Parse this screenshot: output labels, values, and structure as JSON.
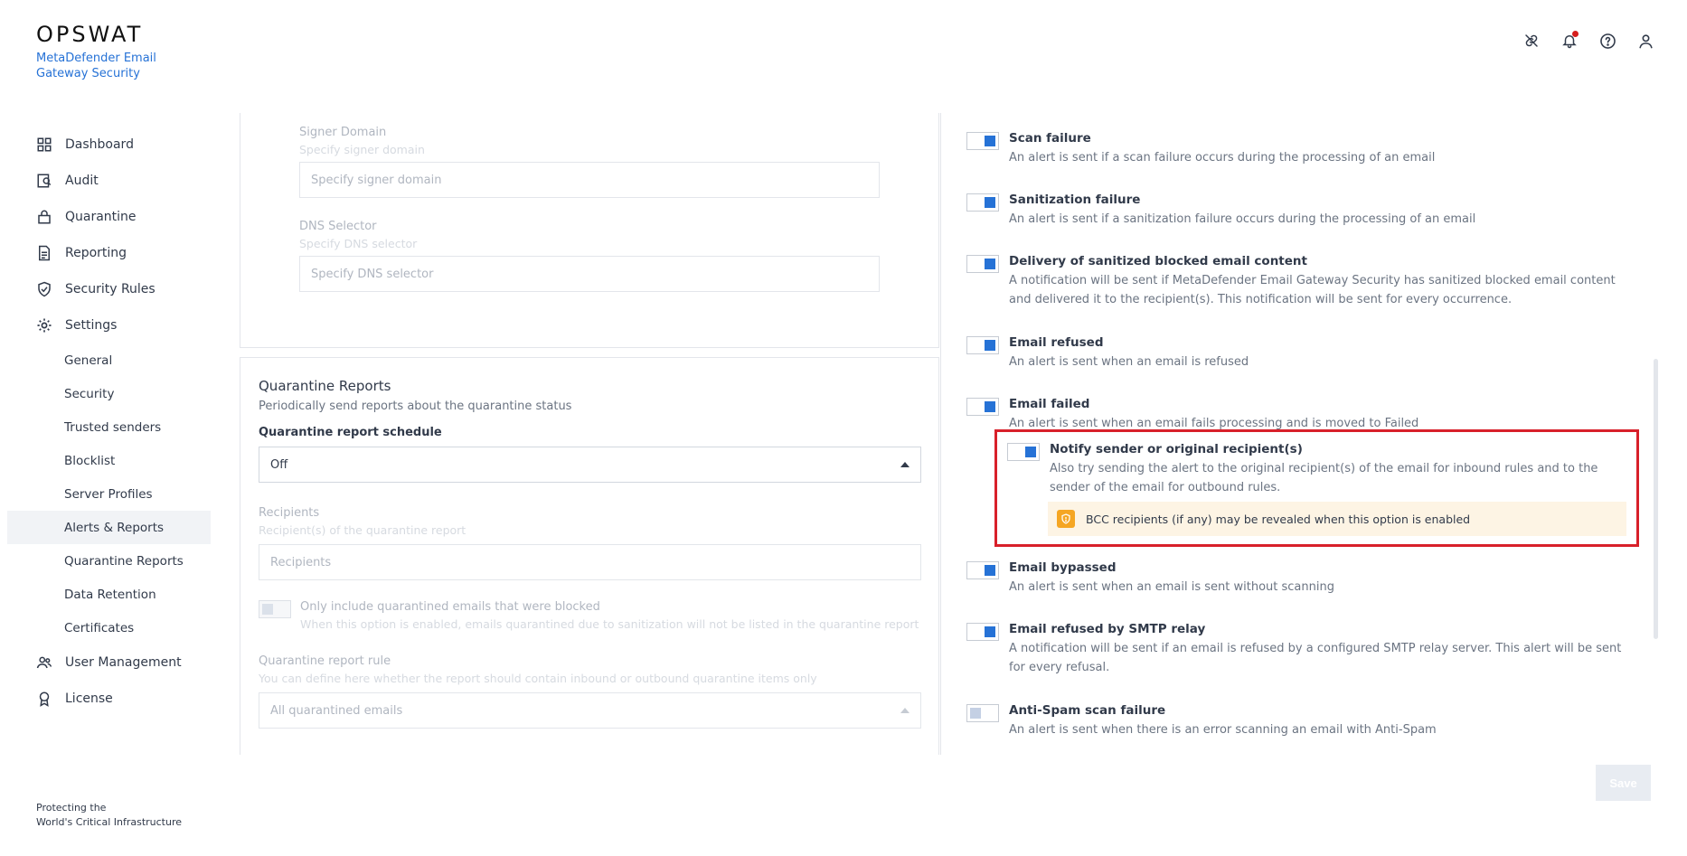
{
  "brand": {
    "logo": "OPSWAT",
    "product": "MetaDefender Email Gateway Security",
    "footer_line1": "Protecting the",
    "footer_line2": "World's Critical Infrastructure"
  },
  "header_icons": [
    "link-icon",
    "bell-icon",
    "help-icon",
    "user-icon"
  ],
  "sidebar": {
    "items": [
      {
        "label": "Dashboard",
        "icon": "dashboard-icon"
      },
      {
        "label": "Audit",
        "icon": "audit-icon"
      },
      {
        "label": "Quarantine",
        "icon": "lock-icon"
      },
      {
        "label": "Reporting",
        "icon": "document-icon"
      },
      {
        "label": "Security Rules",
        "icon": "shield-check-icon"
      },
      {
        "label": "Settings",
        "icon": "gear-icon"
      }
    ],
    "settings_sub": [
      "General",
      "Security",
      "Trusted senders",
      "Blocklist",
      "Server Profiles",
      "Alerts & Reports",
      "Quarantine Reports",
      "Data Retention",
      "Certificates"
    ],
    "bottom_items": [
      {
        "label": "User Management",
        "icon": "users-icon"
      },
      {
        "label": "License",
        "icon": "badge-icon"
      }
    ]
  },
  "dkim": {
    "signer_domain_label": "Signer Domain",
    "signer_domain_hint": "Specify signer domain",
    "signer_domain_placeholder": "Specify signer domain",
    "dns_selector_label": "DNS Selector",
    "dns_selector_hint": "Specify DNS selector",
    "dns_selector_placeholder": "Specify DNS selector"
  },
  "quarantine_reports": {
    "title": "Quarantine Reports",
    "subtitle": "Periodically send reports about the quarantine status",
    "schedule_label": "Quarantine report schedule",
    "schedule_value": "Off",
    "recipients_label": "Recipients",
    "recipients_hint": "Recipient(s) of the quarantine report",
    "recipients_placeholder": "Recipients",
    "only_blocked_label": "Only include quarantined emails that were blocked",
    "only_blocked_hint": "When this option is enabled, emails quarantined due to sanitization will not be listed in the quarantine report",
    "rule_label": "Quarantine report rule",
    "rule_hint": "You can define here whether the report should contain inbound or outbound quarantine items only",
    "rule_value": "All quarantined emails"
  },
  "alerts": [
    {
      "title": "Scan failure",
      "desc": "An alert is sent if a scan failure occurs during the processing of an email",
      "on": true
    },
    {
      "title": "Sanitization failure",
      "desc": "An alert is sent if a sanitization failure occurs during the processing of an email",
      "on": true
    },
    {
      "title": "Delivery of sanitized blocked email content",
      "desc": "A notification will be sent if MetaDefender Email Gateway Security has sanitized blocked email content and delivered it to the recipient(s). This notification will be sent for every occurrence.",
      "on": true
    },
    {
      "title": "Email refused",
      "desc": "An alert is sent when an email is refused",
      "on": true
    },
    {
      "title": "Email failed",
      "desc": "An alert is sent when an email fails processing and is moved to Failed",
      "on": true
    },
    {
      "title": "Email bypassed",
      "desc": "An alert is sent when an email is sent without scanning",
      "on": true
    },
    {
      "title": "Email refused by SMTP relay",
      "desc": "A notification will be sent if an email is refused by a configured SMTP relay server. This alert will be sent for every refusal.",
      "on": true
    },
    {
      "title": "Anti-Spam scan failure",
      "desc": "An alert is sent when there is an error scanning an email with Anti-Spam",
      "on": false
    }
  ],
  "notify": {
    "title": "Notify sender or original recipient(s)",
    "desc": "Also try sending the alert to the original recipient(s) of the email for inbound rules and to the sender of the email for outbound rules.",
    "warning": "BCC recipients (if any) may be revealed when this option is enabled"
  },
  "save_label": "Save"
}
